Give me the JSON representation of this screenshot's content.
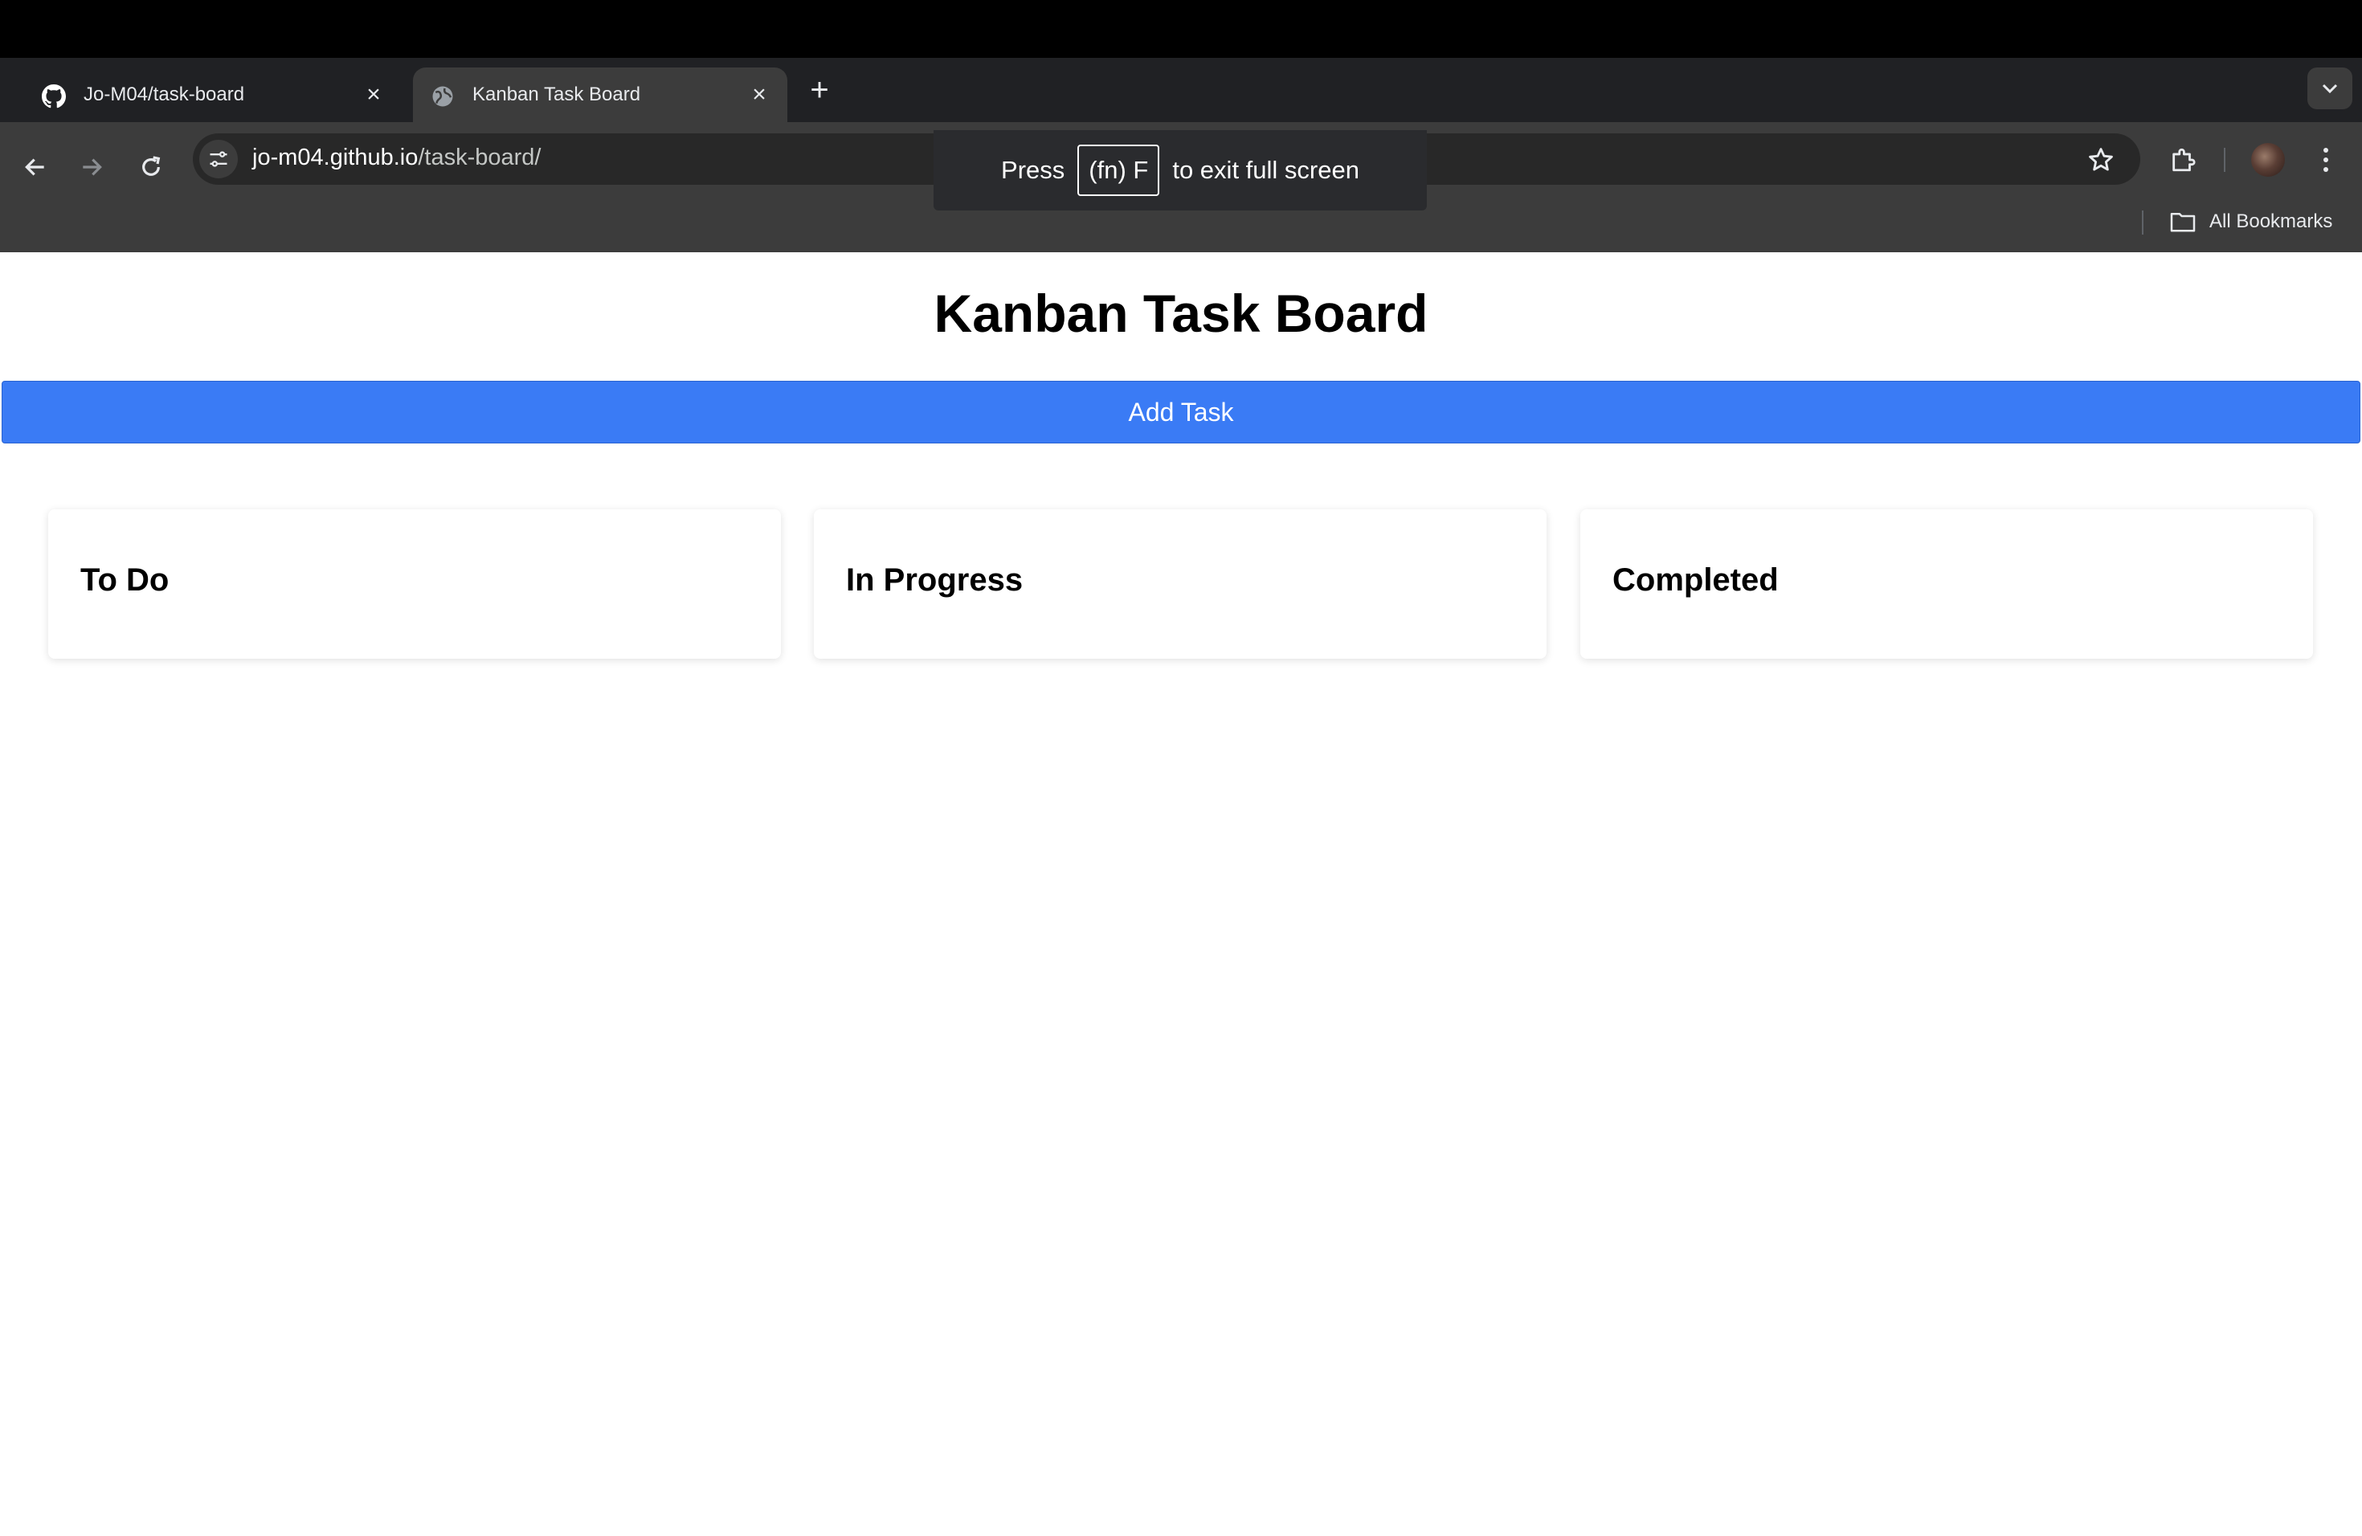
{
  "browser": {
    "tabs": [
      {
        "title": "Jo-M04/task-board",
        "favicon": "github-icon",
        "active": false
      },
      {
        "title": "Kanban Task Board",
        "favicon": "globe-icon",
        "active": true
      }
    ],
    "url_host": "jo-m04.github.io",
    "url_path": "/task-board/",
    "bookmarks_label": "All Bookmarks",
    "fullscreen_toast": {
      "prefix": "Press",
      "key": "(fn) F",
      "suffix": "to exit full screen"
    }
  },
  "page": {
    "title": "Kanban Task Board",
    "add_button_label": "Add Task",
    "columns": [
      {
        "title": "To Do"
      },
      {
        "title": "In Progress"
      },
      {
        "title": "Completed"
      }
    ],
    "accent_color": "#3a7bf5"
  }
}
